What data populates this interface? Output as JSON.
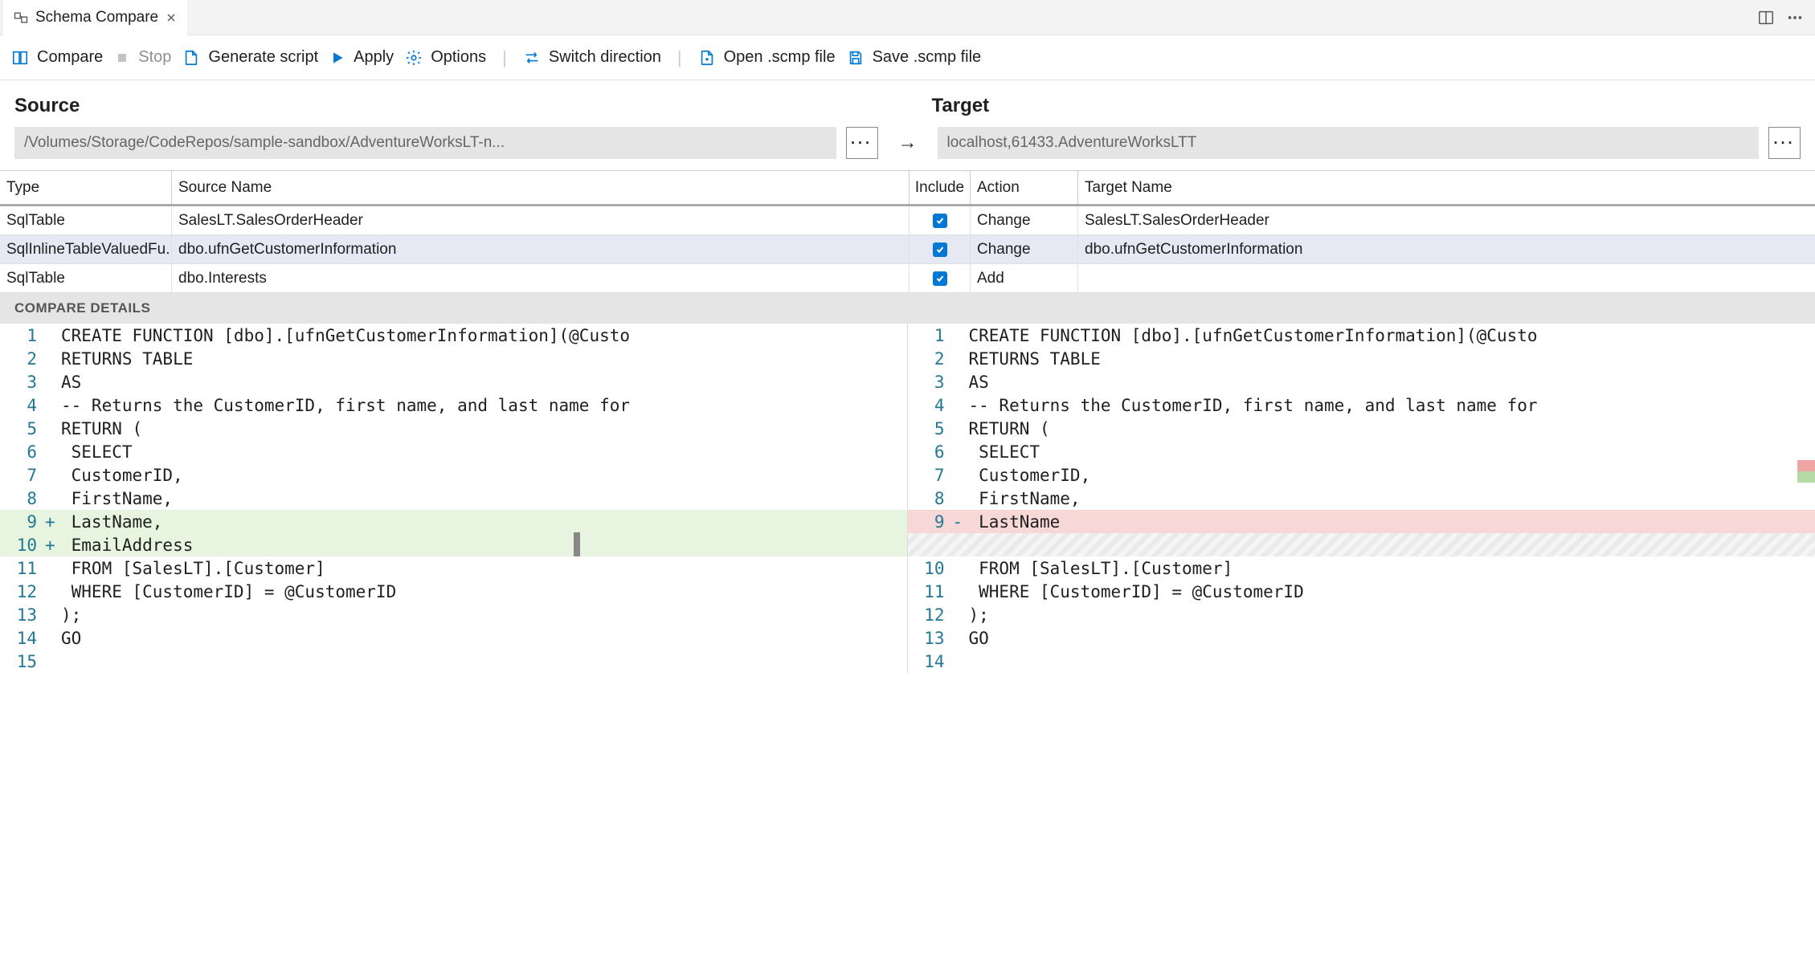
{
  "tab": {
    "label": "Schema Compare"
  },
  "toolbar": {
    "compare": "Compare",
    "stop": "Stop",
    "generate_script": "Generate script",
    "apply": "Apply",
    "options": "Options",
    "switch_direction": "Switch direction",
    "open_scmp": "Open .scmp file",
    "save_scmp": "Save .scmp file"
  },
  "headers": {
    "source": "Source",
    "target": "Target"
  },
  "paths": {
    "source": "/Volumes/Storage/CodeRepos/sample-sandbox/AdventureWorksLT-n...",
    "target": "localhost,61433.AdventureWorksLTT"
  },
  "table": {
    "cols": {
      "type": "Type",
      "source_name": "Source Name",
      "include": "Include",
      "action": "Action",
      "target_name": "Target Name"
    },
    "rows": [
      {
        "type": "SqlTable",
        "source": "SalesLT.SalesOrderHeader",
        "include": true,
        "action": "Change",
        "target": "SalesLT.SalesOrderHeader",
        "selected": false
      },
      {
        "type": "SqlInlineTableValuedFu...",
        "source": "dbo.ufnGetCustomerInformation",
        "include": true,
        "action": "Change",
        "target": "dbo.ufnGetCustomerInformation",
        "selected": true
      },
      {
        "type": "SqlTable",
        "source": "dbo.Interests",
        "include": true,
        "action": "Add",
        "target": "",
        "selected": false
      }
    ]
  },
  "details_header": "COMPARE DETAILS",
  "diff": {
    "left": [
      {
        "n": "1",
        "m": "",
        "t": "CREATE FUNCTION [dbo].[ufnGetCustomerInformation](@Custo",
        "cls": ""
      },
      {
        "n": "2",
        "m": "",
        "t": "RETURNS TABLE",
        "cls": ""
      },
      {
        "n": "3",
        "m": "",
        "t": "AS",
        "cls": ""
      },
      {
        "n": "4",
        "m": "",
        "t": "-- Returns the CustomerID, first name, and last name for",
        "cls": ""
      },
      {
        "n": "5",
        "m": "",
        "t": "RETURN (",
        "cls": ""
      },
      {
        "n": "6",
        "m": "",
        "t": " SELECT",
        "cls": ""
      },
      {
        "n": "7",
        "m": "",
        "t": " CustomerID,",
        "cls": ""
      },
      {
        "n": "8",
        "m": "",
        "t": " FirstName,",
        "cls": ""
      },
      {
        "n": "9",
        "m": "+",
        "t": " LastName,",
        "cls": "added"
      },
      {
        "n": "10",
        "m": "+",
        "t": " EmailAddress",
        "cls": "added"
      },
      {
        "n": "11",
        "m": "",
        "t": " FROM [SalesLT].[Customer]",
        "cls": ""
      },
      {
        "n": "12",
        "m": "",
        "t": " WHERE [CustomerID] = @CustomerID",
        "cls": ""
      },
      {
        "n": "13",
        "m": "",
        "t": ");",
        "cls": ""
      },
      {
        "n": "14",
        "m": "",
        "t": "GO",
        "cls": ""
      },
      {
        "n": "15",
        "m": "",
        "t": "",
        "cls": ""
      }
    ],
    "right": [
      {
        "n": "1",
        "m": "",
        "t": "CREATE FUNCTION [dbo].[ufnGetCustomerInformation](@Custo",
        "cls": ""
      },
      {
        "n": "2",
        "m": "",
        "t": "RETURNS TABLE",
        "cls": ""
      },
      {
        "n": "3",
        "m": "",
        "t": "AS",
        "cls": ""
      },
      {
        "n": "4",
        "m": "",
        "t": "-- Returns the CustomerID, first name, and last name for",
        "cls": ""
      },
      {
        "n": "5",
        "m": "",
        "t": "RETURN (",
        "cls": ""
      },
      {
        "n": "6",
        "m": "",
        "t": " SELECT",
        "cls": ""
      },
      {
        "n": "7",
        "m": "",
        "t": " CustomerID,",
        "cls": ""
      },
      {
        "n": "8",
        "m": "",
        "t": " FirstName,",
        "cls": ""
      },
      {
        "n": "9",
        "m": "-",
        "t": " LastName",
        "cls": "removed"
      },
      {
        "n": "",
        "m": "",
        "t": "",
        "cls": "hatch"
      },
      {
        "n": "10",
        "m": "",
        "t": " FROM [SalesLT].[Customer]",
        "cls": ""
      },
      {
        "n": "11",
        "m": "",
        "t": " WHERE [CustomerID] = @CustomerID",
        "cls": ""
      },
      {
        "n": "12",
        "m": "",
        "t": ");",
        "cls": ""
      },
      {
        "n": "13",
        "m": "",
        "t": "GO",
        "cls": ""
      },
      {
        "n": "14",
        "m": "",
        "t": "",
        "cls": ""
      }
    ]
  }
}
